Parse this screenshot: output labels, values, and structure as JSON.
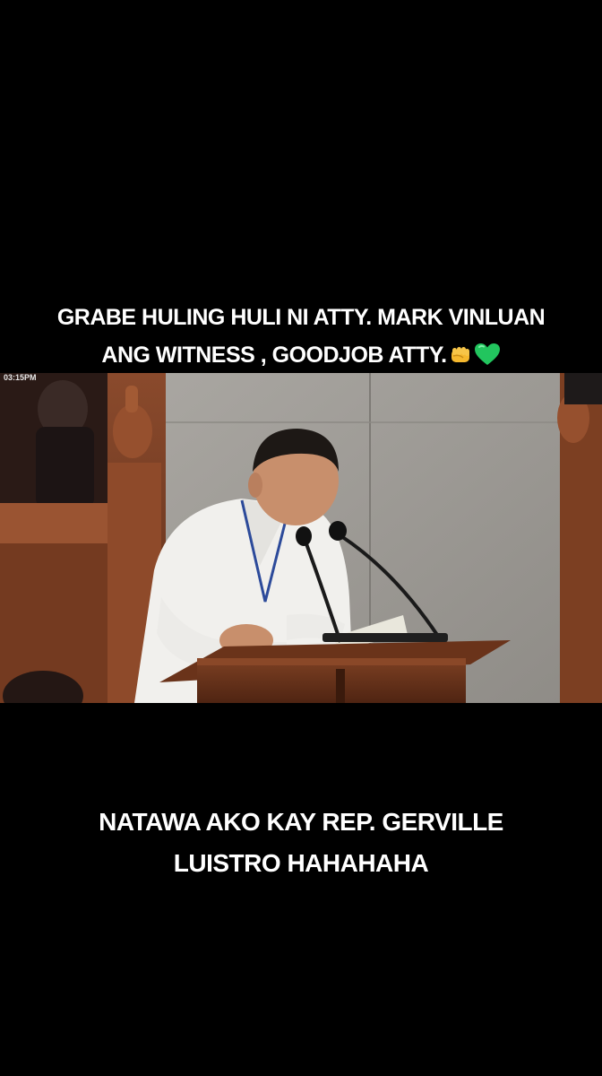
{
  "captions": {
    "top_line1": "GRABE HULING HULI NI ATTY. MARK VINLUAN",
    "top_line2": "ANG WITNESS , GOODJOB ATTY.",
    "top_emoji": [
      "fist-icon",
      "green-heart-icon"
    ],
    "bottom_line1": "NATAWA AKO KAY REP. GERVILLE",
    "bottom_line2": "LUISTRO HAHAHAHA"
  },
  "video": {
    "timestamp": "03:15PM"
  },
  "colors": {
    "background": "#000000",
    "caption_text": "#ffffff",
    "heart": "#22c55e",
    "fist": "#f5b82e"
  }
}
